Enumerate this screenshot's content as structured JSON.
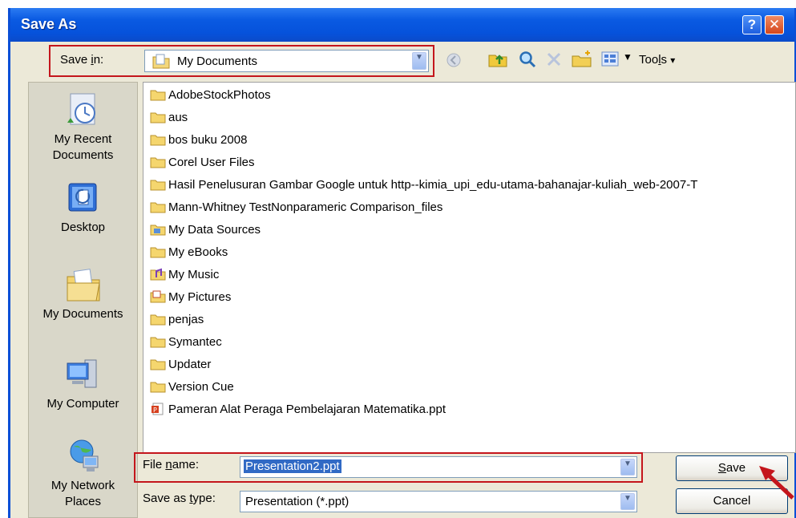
{
  "window": {
    "title": "Save As"
  },
  "title_buttons": {
    "help": "?",
    "close": "✕"
  },
  "toolbar": {
    "save_in_label_prefix": "Save ",
    "save_in_label_u": "i",
    "save_in_label_suffix": "n:",
    "save_in_value": "My Documents",
    "tools_label_prefix": "Too",
    "tools_label_u": "l",
    "tools_label_suffix": "s",
    "tools_arrow": "▾"
  },
  "places": [
    {
      "label_line1": "My Recent",
      "label_line2": "Documents",
      "icon": "recent-documents-icon"
    },
    {
      "label_line1": "Desktop",
      "label_line2": "",
      "icon": "desktop-icon"
    },
    {
      "label_line1": "My Documents",
      "label_line2": "",
      "icon": "my-documents-icon"
    },
    {
      "label_line1": "My Computer",
      "label_line2": "",
      "icon": "my-computer-icon"
    },
    {
      "label_line1": "My Network",
      "label_line2": "Places",
      "icon": "network-places-icon"
    }
  ],
  "files": [
    {
      "name": "AdobeStockPhotos",
      "type": "folder"
    },
    {
      "name": "aus",
      "type": "folder"
    },
    {
      "name": "bos buku 2008",
      "type": "folder"
    },
    {
      "name": "Corel User Files",
      "type": "folder"
    },
    {
      "name": "Hasil Penelusuran Gambar Google untuk http--kimia_upi_edu-utama-bahanajar-kuliah_web-2007-T",
      "type": "folder"
    },
    {
      "name": "Mann-Whitney TestNonparameric Comparison_files",
      "type": "folder"
    },
    {
      "name": "My Data Sources",
      "type": "data-sources"
    },
    {
      "name": "My eBooks",
      "type": "folder"
    },
    {
      "name": "My Music",
      "type": "music"
    },
    {
      "name": "My Pictures",
      "type": "pictures"
    },
    {
      "name": "penjas",
      "type": "folder"
    },
    {
      "name": "Symantec",
      "type": "folder"
    },
    {
      "name": "Updater",
      "type": "folder"
    },
    {
      "name": "Version Cue",
      "type": "folder"
    },
    {
      "name": "Pameran Alat Peraga Pembelajaran Matematika.ppt",
      "type": "ppt"
    }
  ],
  "filename": {
    "label_prefix": "File ",
    "label_u": "n",
    "label_suffix": "ame:",
    "value": "Presentation2.ppt"
  },
  "savetype": {
    "label_prefix": "Save as ",
    "label_u": "t",
    "label_suffix": "ype:",
    "value": "Presentation (*.ppt)"
  },
  "buttons": {
    "save_u": "S",
    "save_rest": "ave",
    "cancel": "Cancel"
  },
  "colors": {
    "highlight": "#c4161c",
    "selection": "#316ac5",
    "titlebar": "#0a5ae2"
  }
}
